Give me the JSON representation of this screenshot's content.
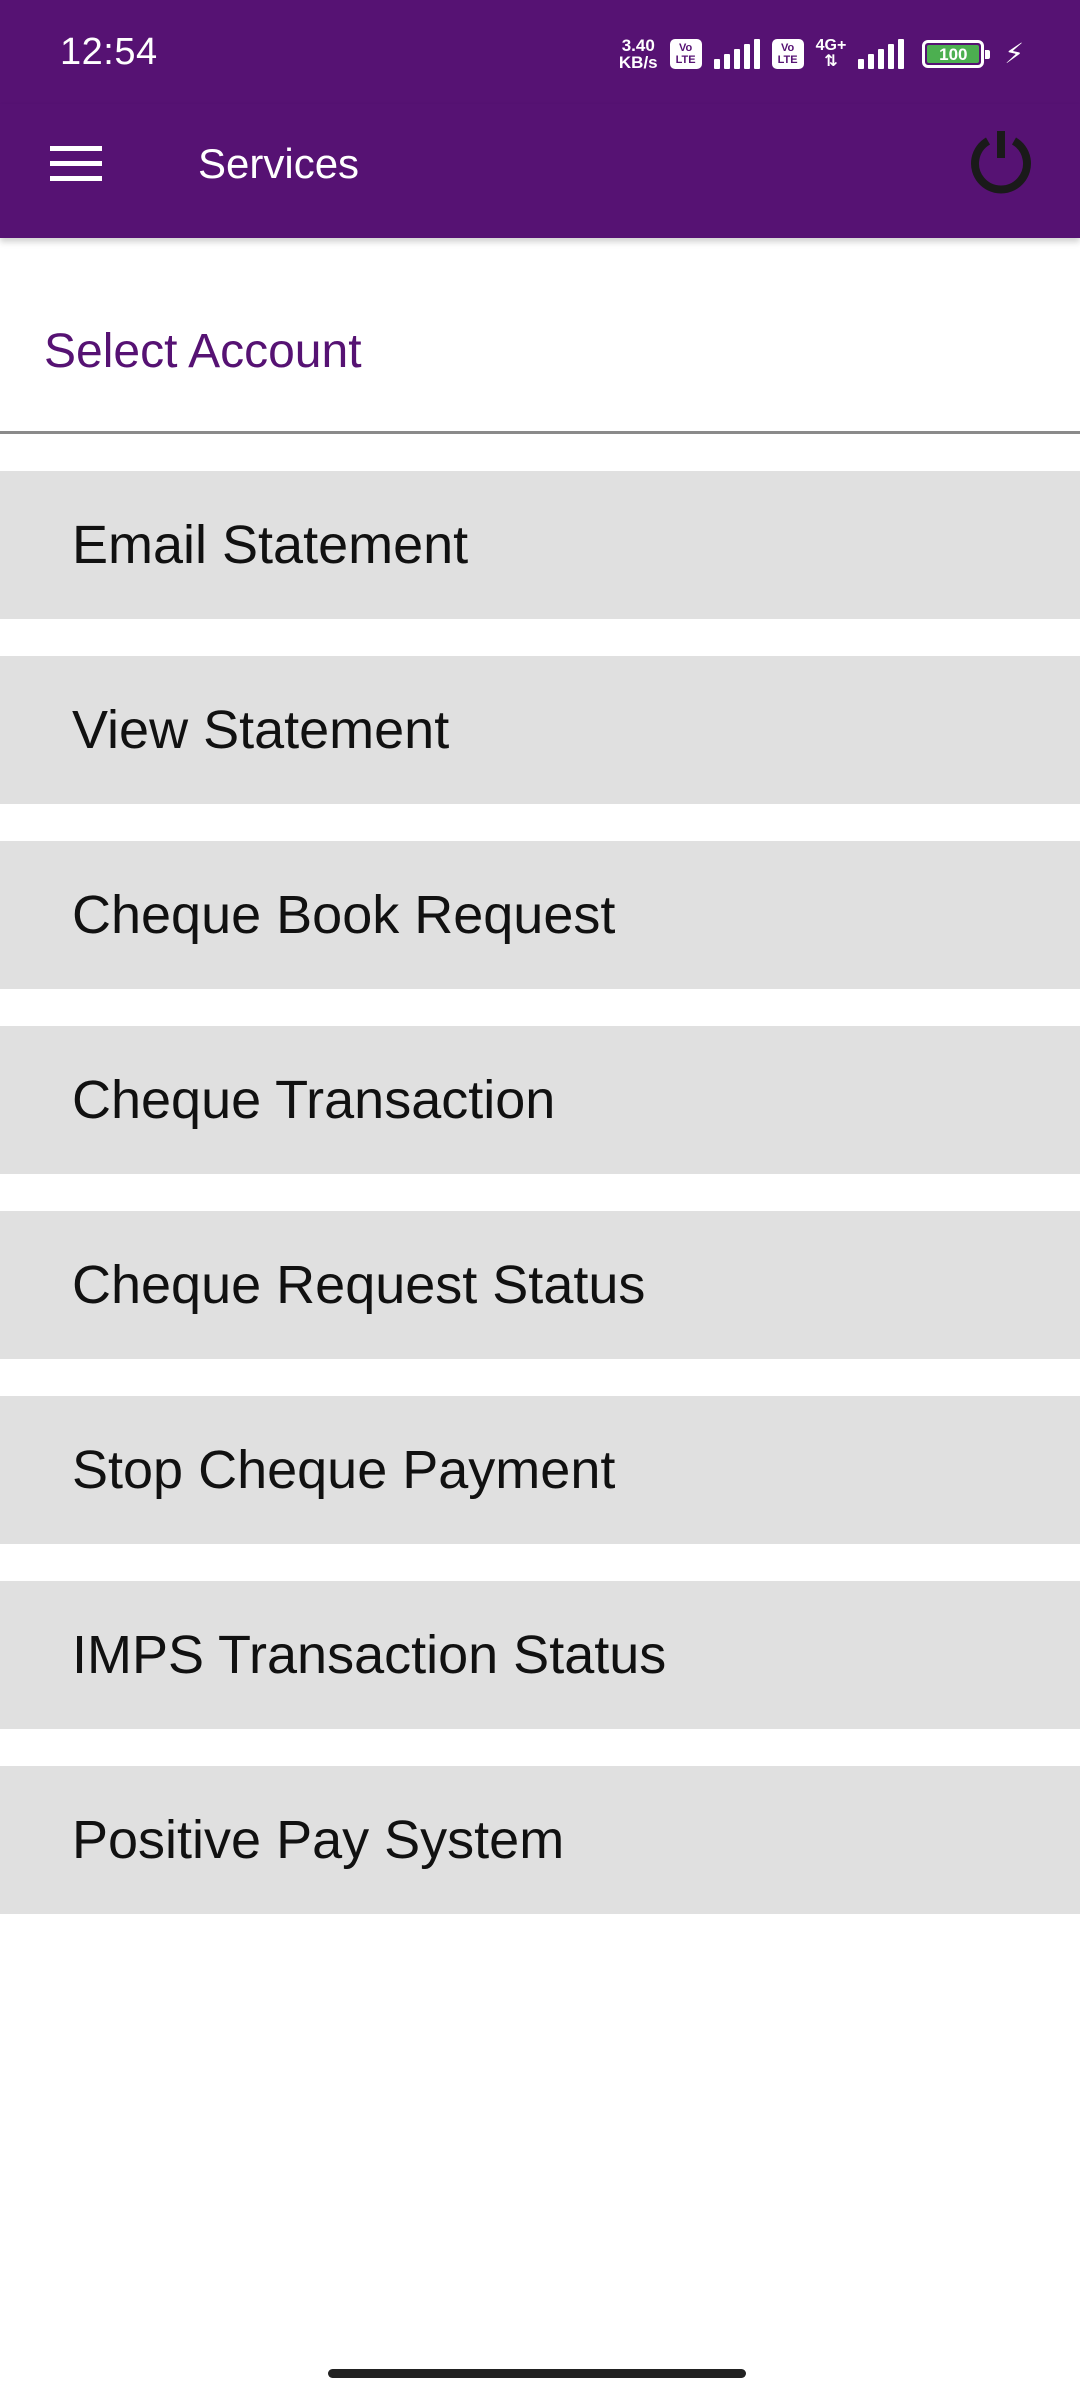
{
  "status_bar": {
    "time": "12:54",
    "net_speed_value": "3.40",
    "net_speed_unit": "KB/s",
    "volte_top": "Vo",
    "volte_bottom": "LTE",
    "network_type": "4G+",
    "battery_level": "100",
    "battery_color": "#4caf50"
  },
  "app_bar": {
    "title": "Services",
    "menu_icon": "hamburger-menu-icon",
    "power_icon": "power-icon",
    "color": "#561273"
  },
  "account": {
    "label": "Select Account",
    "accent": "#561273"
  },
  "services": [
    {
      "label": "Email Statement"
    },
    {
      "label": "View Statement"
    },
    {
      "label": "Cheque Book Request"
    },
    {
      "label": "Cheque Transaction"
    },
    {
      "label": "Cheque Request Status"
    },
    {
      "label": "Stop Cheque Payment"
    },
    {
      "label": "IMPS Transaction Status"
    },
    {
      "label": "Positive Pay System"
    }
  ]
}
